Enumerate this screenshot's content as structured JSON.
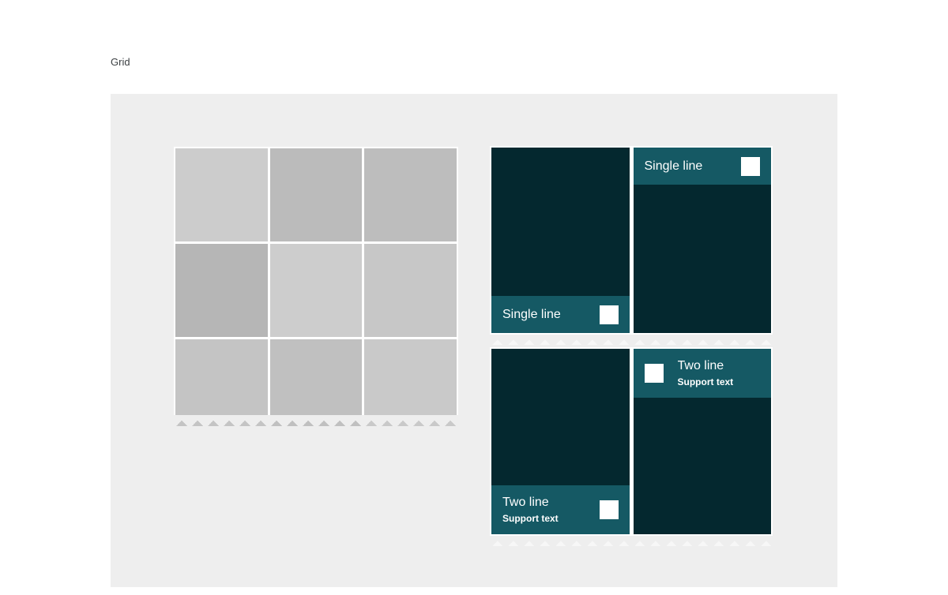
{
  "page": {
    "title": "Grid",
    "background_color": "#ffffff",
    "canvas_color": "#eeeeee"
  },
  "colors": {
    "tile_light": "#cccccc",
    "tile_mid": "#c6c6c6",
    "tile_dark": "#b9b9b9",
    "card_body": "#04282f",
    "card_bar": "#155964",
    "icon": "#ffffff",
    "text_on_card": "#ffffff",
    "title_text": "#3c4043"
  },
  "grid": {
    "label": "Grid",
    "columns": 3,
    "rows": 3,
    "tiles": [
      {
        "id": "tile-1",
        "color": "#cccccc"
      },
      {
        "id": "tile-2",
        "color": "#bbbbbb"
      },
      {
        "id": "tile-3",
        "color": "#bdbdbd"
      },
      {
        "id": "tile-4",
        "color": "#b6b6b6"
      },
      {
        "id": "tile-5",
        "color": "#cdcdcd"
      },
      {
        "id": "tile-6",
        "color": "#c7c7c7"
      },
      {
        "id": "tile-7",
        "color": "#c4c4c4"
      },
      {
        "id": "tile-8",
        "color": "#c0c0c0"
      },
      {
        "id": "tile-9",
        "color": "#c9c9c9"
      }
    ]
  },
  "card_groups": [
    {
      "id": "single-line-group",
      "cards": [
        {
          "id": "single-line-bottom",
          "bar_position": "bottom",
          "lines": "single",
          "icon_position": "right",
          "title": "Single line",
          "support": "",
          "icon": "square-placeholder-icon"
        },
        {
          "id": "single-line-top",
          "bar_position": "top",
          "lines": "single",
          "icon_position": "right",
          "title": "Single line",
          "support": "",
          "icon": "square-placeholder-icon"
        }
      ]
    },
    {
      "id": "two-line-group",
      "cards": [
        {
          "id": "two-line-bottom",
          "bar_position": "bottom",
          "lines": "two",
          "icon_position": "right",
          "title": "Two line",
          "support": "Support text",
          "icon": "square-placeholder-icon"
        },
        {
          "id": "two-line-top",
          "bar_position": "top",
          "lines": "two",
          "icon_position": "left",
          "title": "Two line",
          "support": "Support text",
          "icon": "square-placeholder-icon"
        }
      ]
    }
  ]
}
